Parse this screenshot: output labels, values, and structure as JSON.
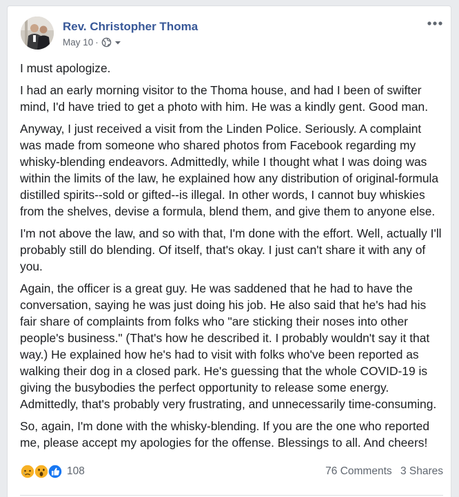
{
  "post": {
    "author": "Rev. Christopher Thoma",
    "date": "May 10",
    "date_separator": "·",
    "privacy_icon": "globe-icon",
    "paragraphs": [
      "I must apologize.",
      "I had an early morning visitor to the Thoma house, and had I been of swifter mind, I'd have tried to get a photo with him. He was a kindly gent. Good man.",
      "Anyway, I just received a visit from the Linden Police. Seriously. A complaint was made from someone who shared photos from Facebook regarding my whisky-blending endeavors. Admittedly, while I thought what I was doing was within the limits of the law, he explained how any distribution of original-formula distilled spirits--sold or gifted--is illegal. In other words, I cannot buy whiskies from the shelves, devise a formula, blend them, and give them to anyone else.",
      "I'm not above the law, and so with that, I'm done with the effort. Well, actually I'll probably still do blending. Of itself, that's okay. I just can't share it with any of you.",
      "Again, the officer is a great guy. He was saddened that he had to have the conversation, saying he was just doing his job. He also said that he's had his fair share of complaints from folks who \"are sticking their noses into other people's business.\" (That's how he described it. I probably wouldn't say it that way.) He explained how he's had to visit with folks who've been reported as walking their dog in a closed park. He's guessing that the whole COVID-19 is giving the busybodies the perfect opportunity to release some energy. Admittedly, that's probably very frustrating, and unnecessarily time-consuming.",
      "So, again, I'm done with the whisky-blending. If you are the one who reported me, please accept my apologies for the offense. Blessings to all. And cheers!"
    ]
  },
  "footer": {
    "reaction_icons": [
      "sad-reaction-icon",
      "wow-reaction-icon",
      "like-reaction-icon"
    ],
    "reaction_count": "108",
    "comments": "76 Comments",
    "shares": "3 Shares"
  },
  "colors": {
    "author_link": "#385898",
    "text": "#1c1e21",
    "meta": "#616770",
    "like_blue": "#1877f2",
    "reaction_yellow": "#f7b125"
  }
}
